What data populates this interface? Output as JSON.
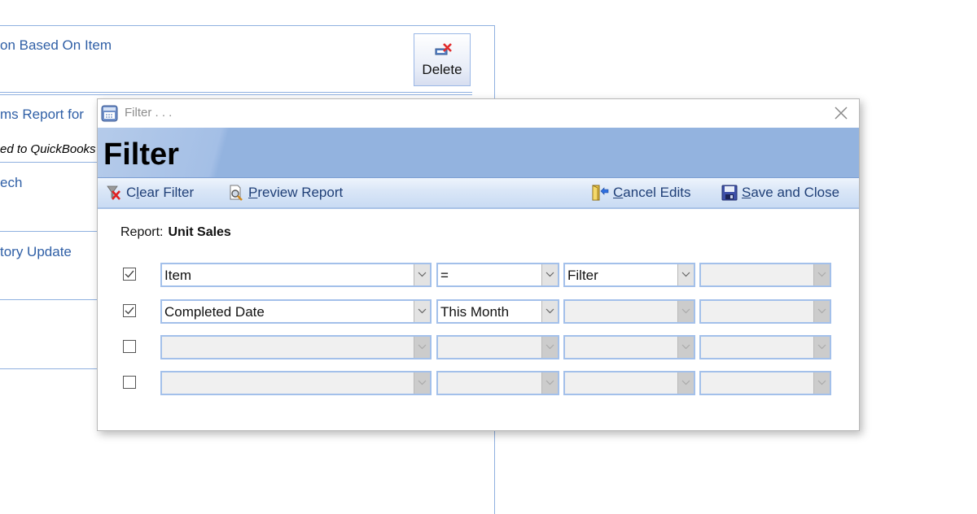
{
  "background_form": {
    "rows": [
      {
        "text": "on Based On Item"
      },
      {
        "text": "ms Report for",
        "subtext": "ed to QuickBooks"
      },
      {
        "text": "ech"
      },
      {
        "text": "tory Update"
      }
    ],
    "delete_button": {
      "label": "Delete",
      "icon": "delete-record-icon"
    }
  },
  "dialog": {
    "window_title": "Filter . . .",
    "window_icon": "form-window-icon",
    "header": "Filter",
    "toolbar": {
      "clear_filter": {
        "pre": "C",
        "accel": "l",
        "post": "ear Filter",
        "icon": "clear-filter-icon"
      },
      "preview_report": {
        "pre": "",
        "accel": "P",
        "post": "review Report",
        "icon": "preview-report-icon"
      },
      "cancel_edits": {
        "pre": "",
        "accel": "C",
        "post": "ancel Edits",
        "icon": "cancel-edits-icon"
      },
      "save_and_close": {
        "pre": "",
        "accel": "S",
        "post": "ave and Close",
        "icon": "save-icon"
      }
    },
    "report_label": "Report:",
    "report_name": "Unit Sales",
    "filter_rows": [
      {
        "checked": true,
        "field": "Item",
        "operator": "=",
        "value": "Filter",
        "extra": "",
        "enabled": [
          true,
          true,
          true,
          false
        ]
      },
      {
        "checked": true,
        "field": "Completed Date",
        "operator": "This Month",
        "value": "",
        "extra": "",
        "enabled": [
          true,
          true,
          false,
          false
        ]
      },
      {
        "checked": false,
        "field": "",
        "operator": "",
        "value": "",
        "extra": "",
        "enabled": [
          false,
          false,
          false,
          false
        ]
      },
      {
        "checked": false,
        "field": "",
        "operator": "",
        "value": "",
        "extra": "",
        "enabled": [
          false,
          false,
          false,
          false
        ]
      }
    ]
  }
}
